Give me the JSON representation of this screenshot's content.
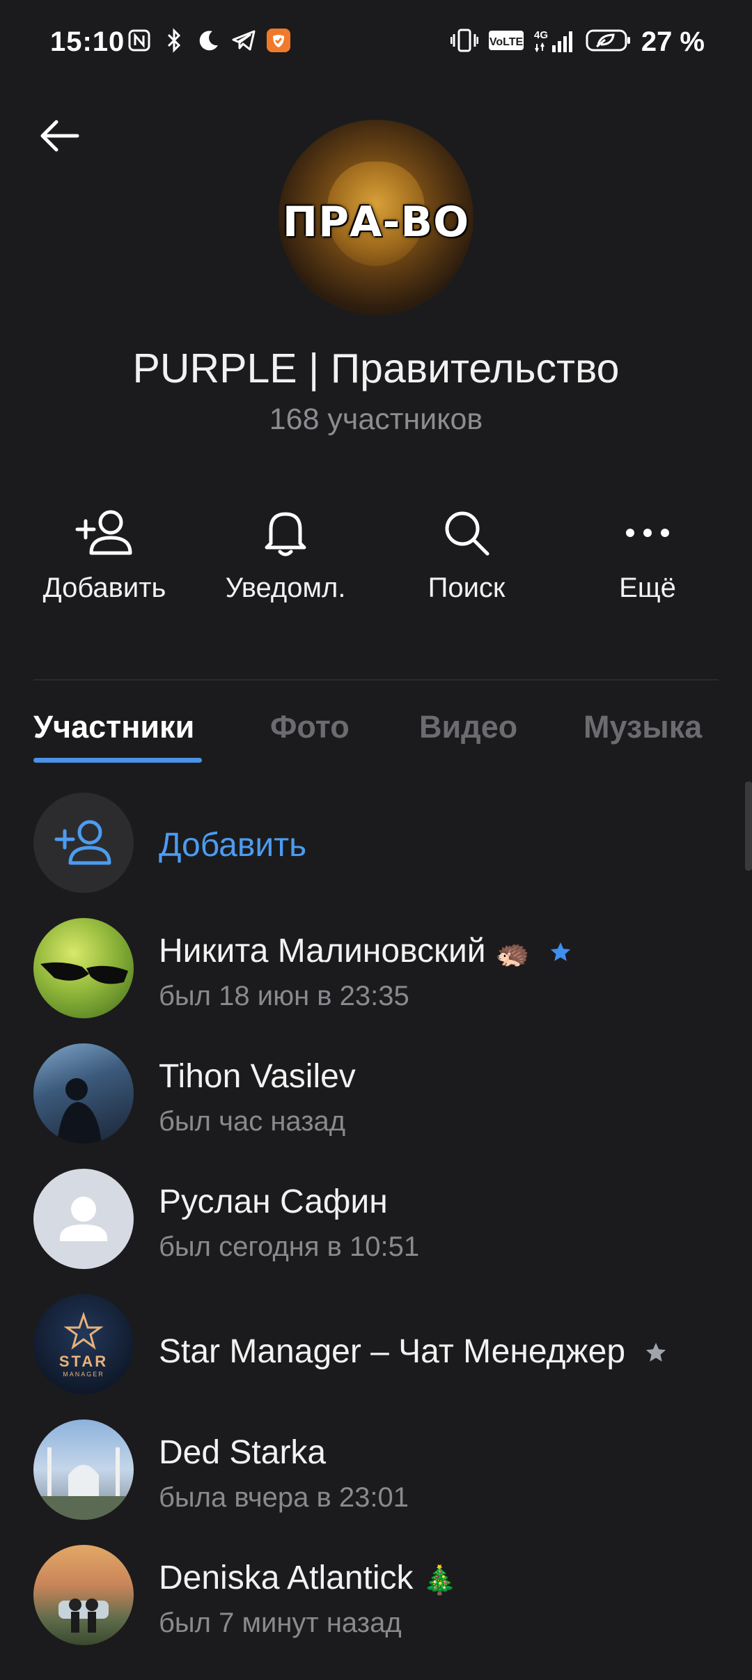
{
  "status_bar": {
    "time": "15:10",
    "battery_percent": "27 %",
    "left_icons": [
      "nfc-icon",
      "bluetooth-icon",
      "moon-icon",
      "telegram-icon",
      "app-shield-icon"
    ],
    "right_icons": [
      "vibrate-icon",
      "volte-icon",
      "signal-4g-icon",
      "battery-icon"
    ]
  },
  "header": {
    "avatar_text": "ПРА-ВО",
    "title": "PURPLE | Правительство",
    "subtitle": "168 участников"
  },
  "actions": [
    {
      "label": "Добавить",
      "icon": "add-user-icon"
    },
    {
      "label": "Уведомл.",
      "icon": "bell-icon"
    },
    {
      "label": "Поиск",
      "icon": "search-icon"
    },
    {
      "label": "Ещё",
      "icon": "more-icon"
    }
  ],
  "tabs": [
    {
      "label": "Участники",
      "active": true
    },
    {
      "label": "Фото",
      "active": false
    },
    {
      "label": "Видео",
      "active": false
    },
    {
      "label": "Музыка",
      "active": false
    }
  ],
  "add_member": {
    "label": "Добавить"
  },
  "members": [
    {
      "name": "Никита Малиновский",
      "emoji": "🦔",
      "badge": "star-blue",
      "status": "был 18 июн в 23:35"
    },
    {
      "name": "Tihon Vasilev",
      "status": "был час назад"
    },
    {
      "name": "Руслан Сафин",
      "status": "был сегодня в 10:51"
    },
    {
      "name": "Star Manager – Чат Менеджер",
      "badge": "star-gray",
      "status": "",
      "avatar_text_top": "STAR",
      "avatar_text_bottom": "MANAGER"
    },
    {
      "name": "Ded Starka",
      "status": "была вчера в 23:01"
    },
    {
      "name": "Deniska Atlantick",
      "emoji": "🎄",
      "status": "был 7 минут назад"
    }
  ],
  "colors": {
    "background": "#1b1b1d",
    "accent": "#4c92e6",
    "secondary_text": "#8a8a8e"
  }
}
